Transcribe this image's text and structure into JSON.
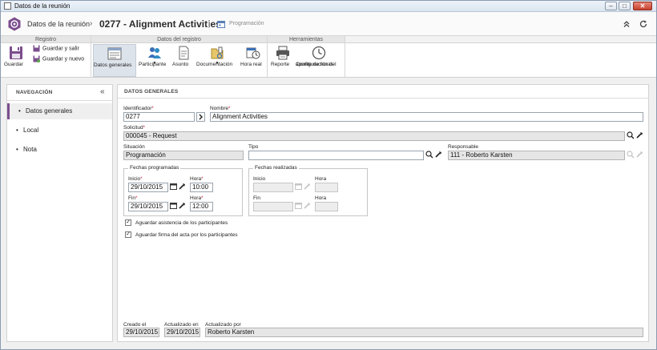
{
  "window": {
    "title": "Datos de la reunión",
    "minimize": "–",
    "maximize": "□",
    "close": "✕"
  },
  "header": {
    "title": "Datos de la reunión",
    "separator": "›",
    "record": "0277 - Alignment Activities",
    "module": "Programación",
    "collapse_icon": "chevron-double-up",
    "refresh_icon": "refresh",
    "brand_color": "#7b4d8e"
  },
  "ribbon": {
    "groups": {
      "registro": "Registro",
      "datos_registro": "Datos del registro",
      "herramientas": "Herramientas"
    },
    "guardar": "Guardar",
    "guardar_salir": "Guardar y salir",
    "guardar_nuevo": "Guardar y nuevo",
    "datos_generales": "Datos generales",
    "participante": "Participante",
    "asunto": "Asunto",
    "documentacion": "Documentación",
    "hora_real": "Hora real",
    "reporte": "Reporte",
    "config_line1": "Configuración del",
    "config_line2": "apunte de horas",
    "dropdown_arrow": "▼"
  },
  "nav": {
    "title": "NAVEGACIÓN",
    "collapse": "«",
    "items": [
      {
        "label": "Datos generales",
        "active": true
      },
      {
        "label": "Local",
        "active": false
      },
      {
        "label": "Nota",
        "active": false
      }
    ],
    "bullet": "•"
  },
  "form": {
    "section_title": "DATOS GENERALES",
    "required_mark": "*",
    "identificador": {
      "label": "Identificador",
      "value": "0277"
    },
    "nombre": {
      "label": "Nombre",
      "value": "Alignment Activities"
    },
    "solicitud": {
      "label": "Solicitud",
      "value": "000045 - Request"
    },
    "situacion": {
      "label": "Situación",
      "value": "Programación"
    },
    "tipo": {
      "label": "Tipo",
      "value": ""
    },
    "responsable": {
      "label": "Responsable",
      "value": "111 - Roberto Karsten"
    },
    "fechas_programadas": {
      "legend": "Fechas programadas",
      "inicio_label": "Inicio",
      "inicio": "29/10/2015",
      "hora_label": "Hora",
      "hora_inicio": "10:00",
      "fin_label": "Fin",
      "fin": "29/10/2015",
      "hora_fin": "12:00"
    },
    "fechas_realizadas": {
      "legend": "Fechas realizadas",
      "inicio_label": "Inicio",
      "hora_label": "Hora",
      "fin_label": "Fin",
      "inicio": "",
      "hora_inicio": "",
      "fin": "",
      "hora_fin": ""
    },
    "checks": [
      {
        "label": "Aguardar asistencia de los participantes",
        "checked": true
      },
      {
        "label": "Aguardar firma del acta por los participantes",
        "checked": true
      }
    ],
    "check_mark": "✓",
    "creado_el": {
      "label": "Creado el",
      "value": "29/10/2015"
    },
    "actualizado_en": {
      "label": "Actualizado en",
      "value": "29/10/2015"
    },
    "actualizado_por": {
      "label": "Actualizado por",
      "value": "Roberto Karsten"
    }
  }
}
